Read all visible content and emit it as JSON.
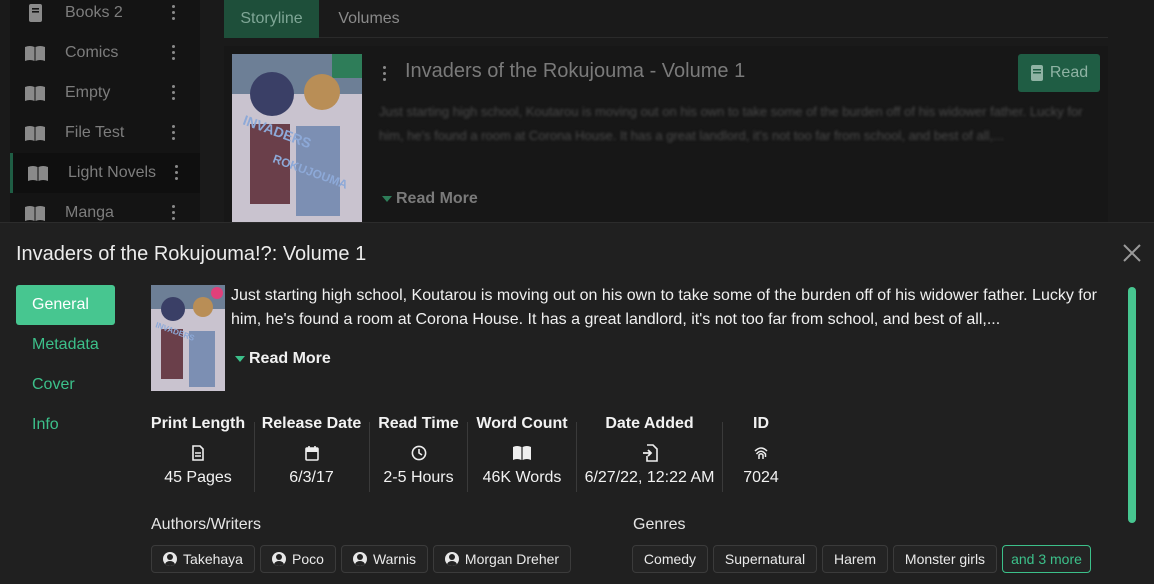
{
  "sidebar": {
    "items": [
      {
        "label": "Books 2",
        "icon": "book-closed-icon"
      },
      {
        "label": "Comics",
        "icon": "book-open-icon"
      },
      {
        "label": "Empty",
        "icon": "book-open-icon"
      },
      {
        "label": "File Test",
        "icon": "book-open-icon"
      },
      {
        "label": "Light Novels",
        "icon": "book-open-icon",
        "active": true
      },
      {
        "label": "Manga",
        "icon": "book-open-icon"
      }
    ]
  },
  "tabs": {
    "storyline": "Storyline",
    "volumes": "Volumes"
  },
  "volume_card": {
    "title": "Invaders of the Rokujouma - Volume 1",
    "read_label": "Read",
    "description": "Just starting high school, Koutarou is moving out on his own to take some of the burden off of his widower father. Lucky for him, he's found a room at Corona House. It has a great landlord, it's not too far from school, and best of all,...",
    "read_more": "Read More"
  },
  "modal": {
    "title": "Invaders of the Rokujouma!?: Volume 1",
    "nav": [
      {
        "label": "General",
        "active": true
      },
      {
        "label": "Metadata"
      },
      {
        "label": "Cover"
      },
      {
        "label": "Info"
      }
    ],
    "description": "Just starting high school, Koutarou is moving out on his own to take some of the burden off of his widower father. Lucky for him, he's found a room at Corona House. It has a great landlord, it's not too far from school, and best of all,...",
    "read_more": "Read More",
    "stats": [
      {
        "heading": "Print Length",
        "icon": "document-icon",
        "value": "45 Pages"
      },
      {
        "heading": "Release Date",
        "icon": "calendar-icon",
        "value": "6/3/17"
      },
      {
        "heading": "Read Time",
        "icon": "clock-icon",
        "value": "2-5 Hours"
      },
      {
        "heading": "Word Count",
        "icon": "open-book-icon",
        "value": "46K Words"
      },
      {
        "heading": "Date Added",
        "icon": "file-import-icon",
        "value": "6/27/22, 12:22 AM"
      },
      {
        "heading": "ID",
        "icon": "fingerprint-icon",
        "value": "7024"
      }
    ],
    "authors_label": "Authors/Writers",
    "authors": [
      "Takehaya",
      "Poco",
      "Warnis",
      "Morgan Dreher"
    ],
    "genres_label": "Genres",
    "genres": [
      "Comedy",
      "Supernatural",
      "Harem",
      "Monster girls"
    ],
    "genres_more": "and 3 more"
  },
  "colors": {
    "accent": "#47c690",
    "accent_text": "#3cc08a",
    "sheet_bg": "#202020"
  }
}
